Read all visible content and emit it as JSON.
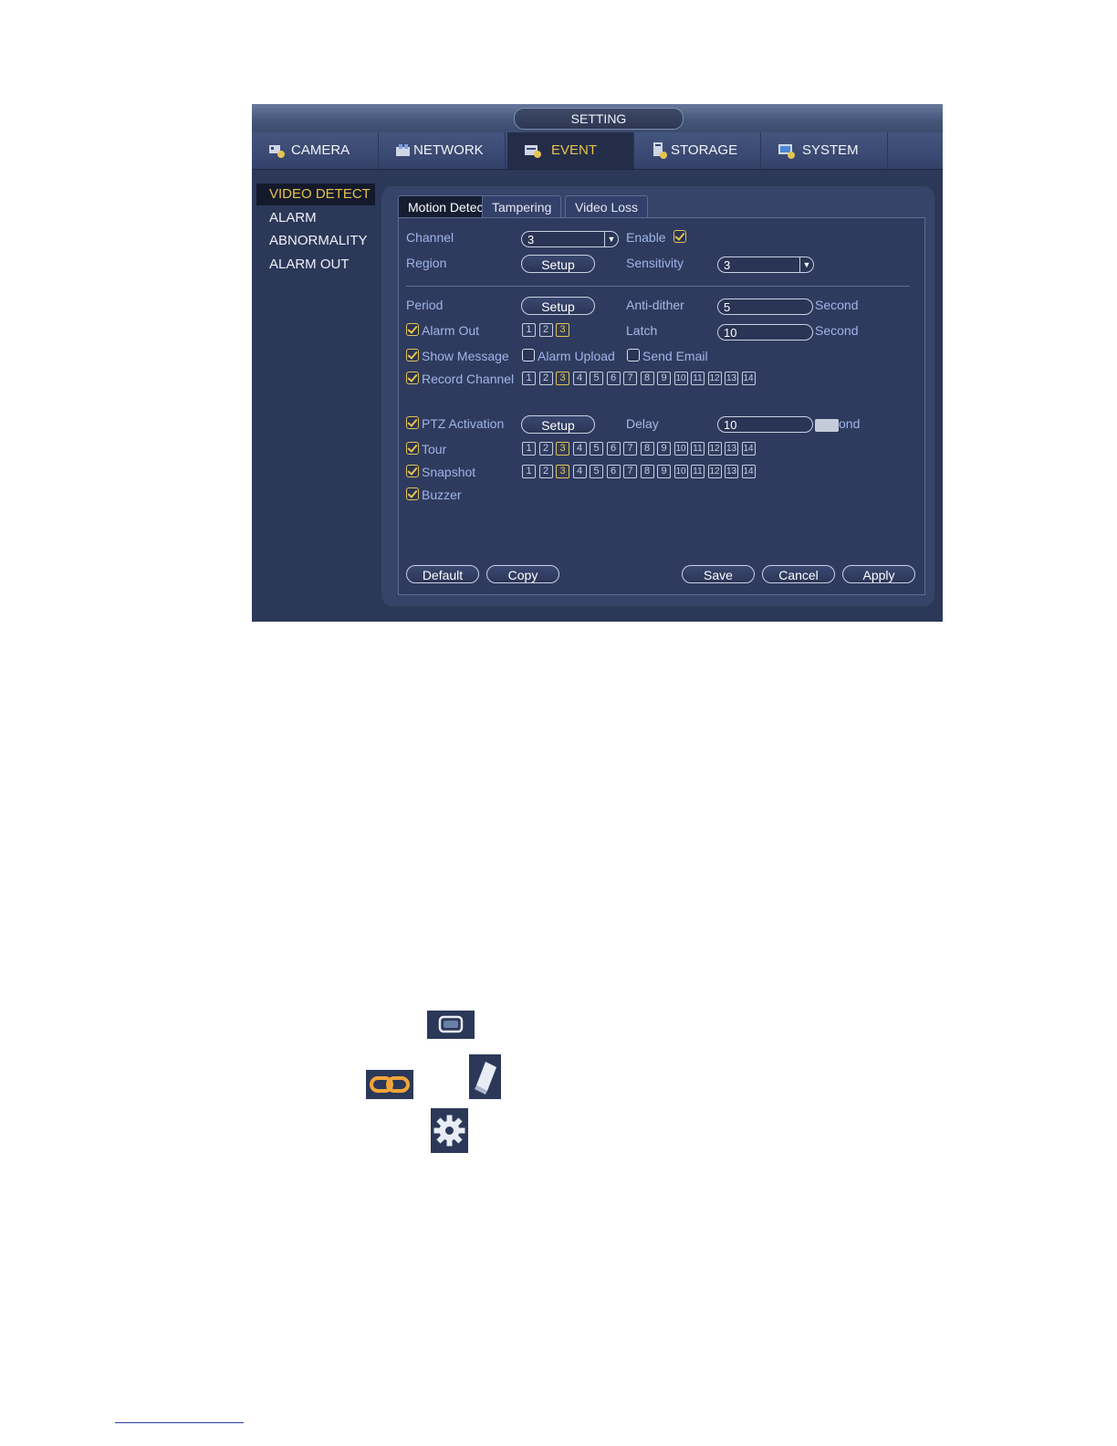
{
  "window": {
    "title": "SETTING"
  },
  "topnav": [
    {
      "label": "CAMERA",
      "icon": "camera-icon"
    },
    {
      "label": "NETWORK",
      "icon": "network-icon"
    },
    {
      "label": "EVENT",
      "icon": "event-icon",
      "active": true
    },
    {
      "label": "STORAGE",
      "icon": "storage-icon"
    },
    {
      "label": "SYSTEM",
      "icon": "system-icon"
    }
  ],
  "sidebar": [
    {
      "label": "VIDEO DETECT",
      "active": true
    },
    {
      "label": "ALARM"
    },
    {
      "label": "ABNORMALITY"
    },
    {
      "label": "ALARM OUT"
    }
  ],
  "subtabs": [
    "Motion Detect",
    "Tampering",
    "Video Loss"
  ],
  "form": {
    "channel_label": "Channel",
    "channel_value": "3",
    "enable_label": "Enable",
    "enable_checked": true,
    "region_label": "Region",
    "region_button": "Setup",
    "sensitivity_label": "Sensitivity",
    "sensitivity_value": "3",
    "period_label": "Period",
    "period_button": "Setup",
    "antidither_label": "Anti-dither",
    "antidither_value": "5",
    "antidither_unit": "Second",
    "alarm_out_label": "Alarm Out",
    "alarm_out_checked": true,
    "alarm_out_numbers": [
      "1",
      "2",
      "3"
    ],
    "alarm_out_selected": [
      "3"
    ],
    "latch_label": "Latch",
    "latch_value": "10",
    "latch_unit": "Second",
    "show_message_label": "Show Message",
    "alarm_upload_label": "Alarm Upload",
    "send_email_label": "Send Email",
    "record_channel_label": "Record Channel",
    "ptz_label": "PTZ Activation",
    "ptz_button": "Setup",
    "delay_label": "Delay",
    "delay_value": "10",
    "delay_unit": "ond",
    "tour_label": "Tour",
    "snapshot_label": "Snapshot",
    "buzzer_label": "Buzzer",
    "channels": [
      "1",
      "2",
      "3",
      "4",
      "5",
      "6",
      "7",
      "8",
      "9",
      "10",
      "11",
      "12",
      "13",
      "14"
    ],
    "selected_channel": "3"
  },
  "buttons": {
    "default": "Default",
    "copy": "Copy",
    "save": "Save",
    "cancel": "Cancel",
    "apply": "Apply"
  },
  "below_icons": [
    "window-icon",
    "link-icon",
    "eraser-icon",
    "gear-icon"
  ],
  "colors": {
    "accent": "#e7c24a",
    "panel": "#2f3b5e",
    "label": "#9fb4e8"
  }
}
